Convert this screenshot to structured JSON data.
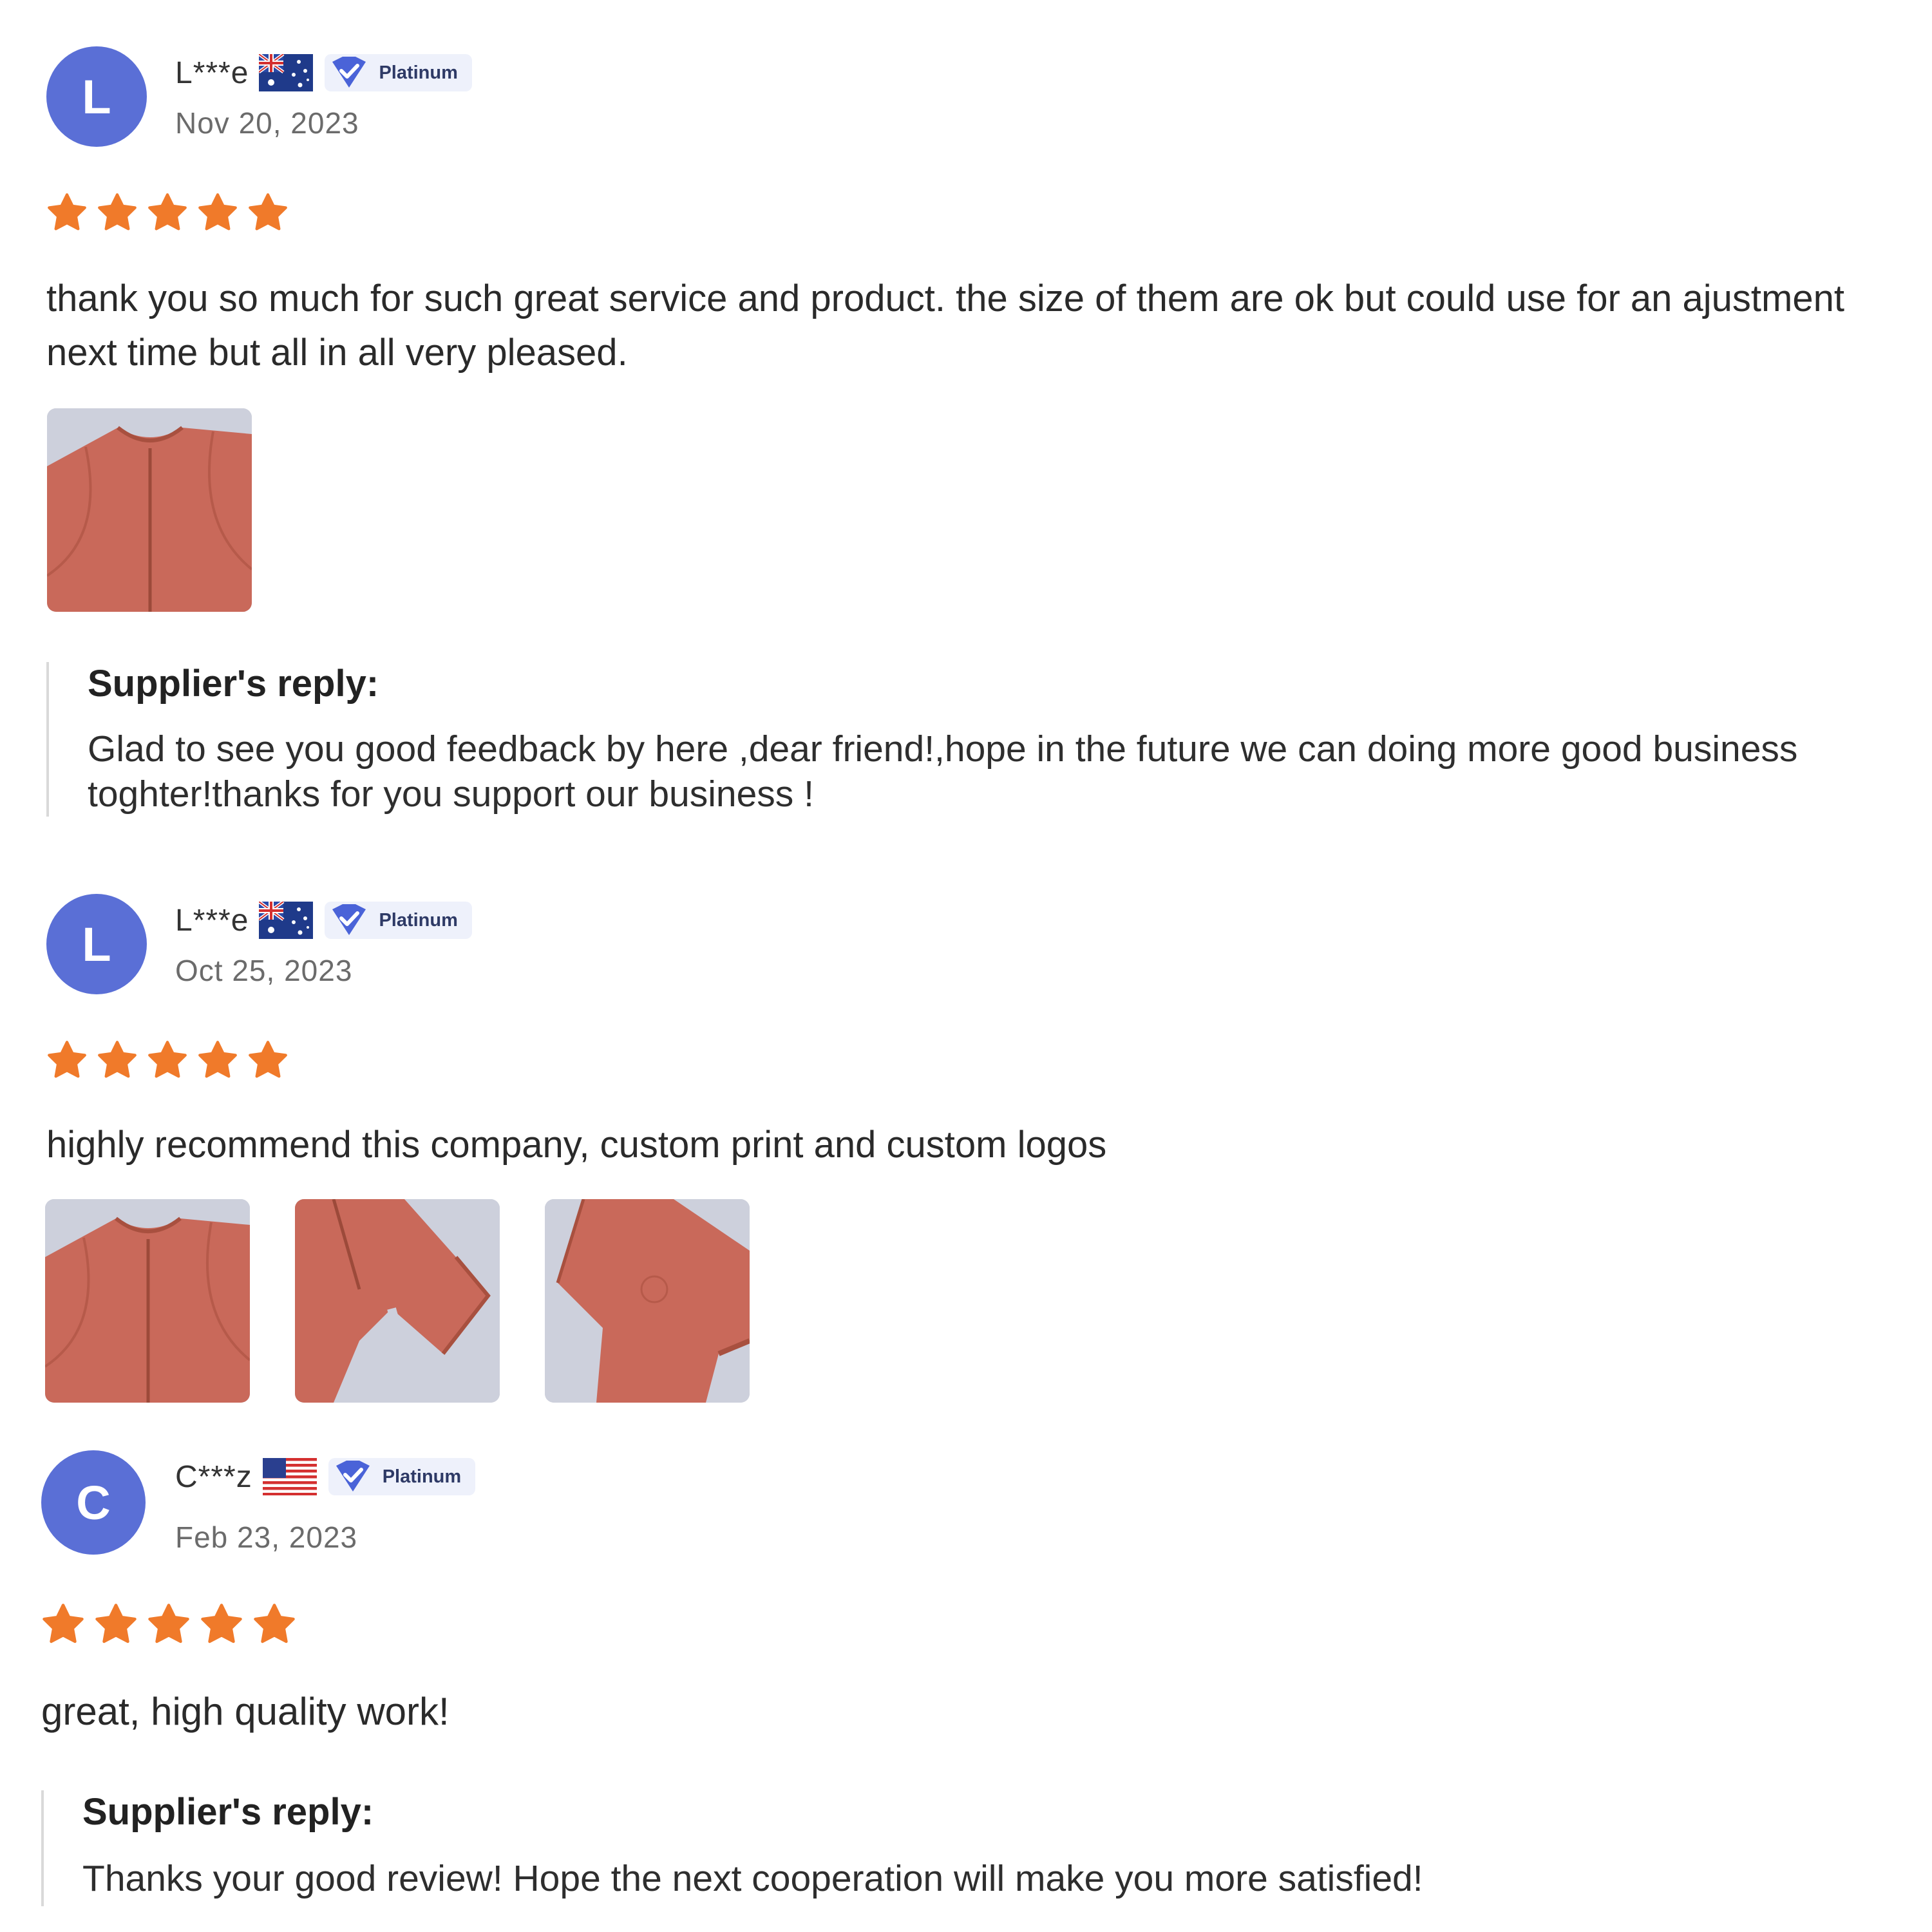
{
  "colors": {
    "avatar": "#5a6fd6",
    "star": "#f07a2a",
    "badge_check": "#4a63d8",
    "product": "#c9695a",
    "thumb_bg": "#cdd0dc"
  },
  "reviews": [
    {
      "avatar_letter": "L",
      "username": "L***e",
      "country_flag": "australia-flag-icon",
      "badge": "Platinum",
      "date": "Nov 20, 2023",
      "rating": 5,
      "text": "thank you so much for such great service and product. the size of them are ok but could use for an ajustment next time but all in all very pleased.",
      "images": [
        "romper-front-zip"
      ],
      "supplier_reply": {
        "title": "Supplier's reply:",
        "text": "Glad to see you good feedback by here ,dear friend!,hope in the future we can doing more good business toghter!thanks for you support our business !"
      }
    },
    {
      "avatar_letter": "L",
      "username": "L***e",
      "country_flag": "australia-flag-icon",
      "badge": "Platinum",
      "date": "Oct 25, 2023",
      "rating": 5,
      "text": "highly recommend this company, custom print and custom logos",
      "images": [
        "romper-front-zip",
        "romper-leg-cuff",
        "romper-sleeve"
      ]
    },
    {
      "avatar_letter": "C",
      "username": "C***z",
      "country_flag": "usa-flag-icon",
      "badge": "Platinum",
      "date": "Feb 23, 2023",
      "rating": 5,
      "text": "great, high quality work!",
      "images": [],
      "supplier_reply": {
        "title": "Supplier's reply:",
        "text": "Thanks your good review! Hope the next cooperation will make you more satisfied!"
      }
    }
  ]
}
